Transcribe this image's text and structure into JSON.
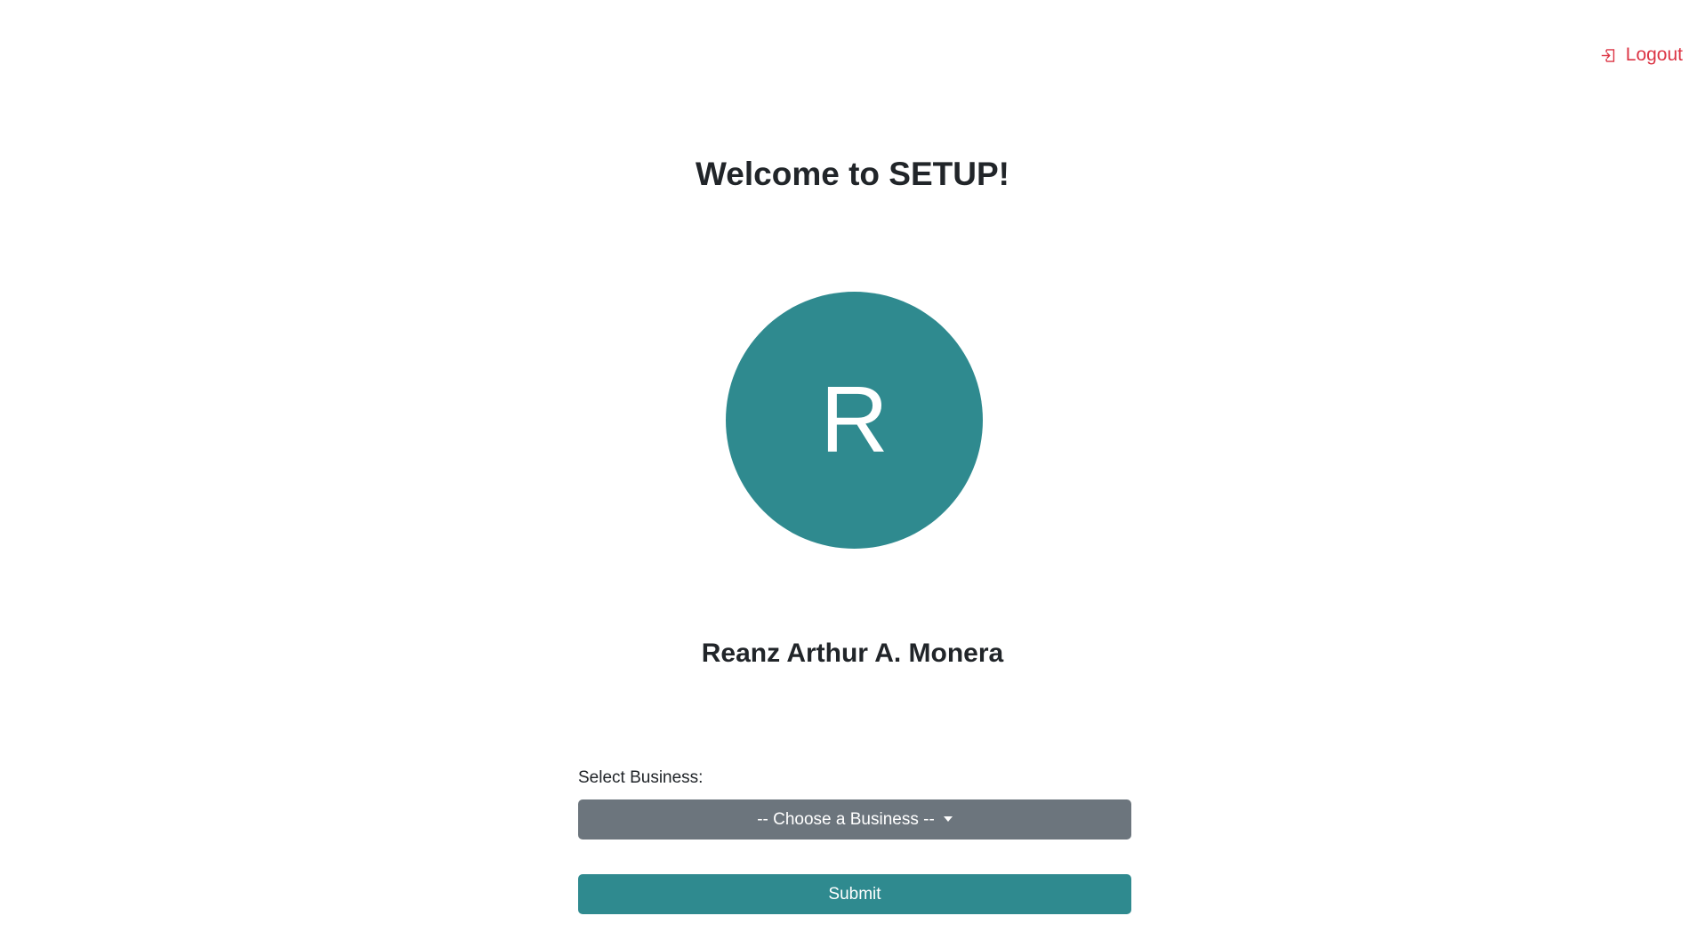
{
  "header": {
    "logout_label": "Logout",
    "logout_icon": "logout-icon"
  },
  "title": "Welcome to SETUP!",
  "avatar": {
    "initial": "R",
    "color": "#2f8a8f"
  },
  "user": {
    "name": "Reanz Arthur A. Monera"
  },
  "form": {
    "select_label": "Select Business:",
    "select_value": "-- Choose a Business --",
    "select_color": "#6c757d",
    "submit_label": "Submit",
    "submit_color": "#2f8a8f"
  },
  "colors": {
    "logout": "#dc3545",
    "text": "#212529"
  }
}
